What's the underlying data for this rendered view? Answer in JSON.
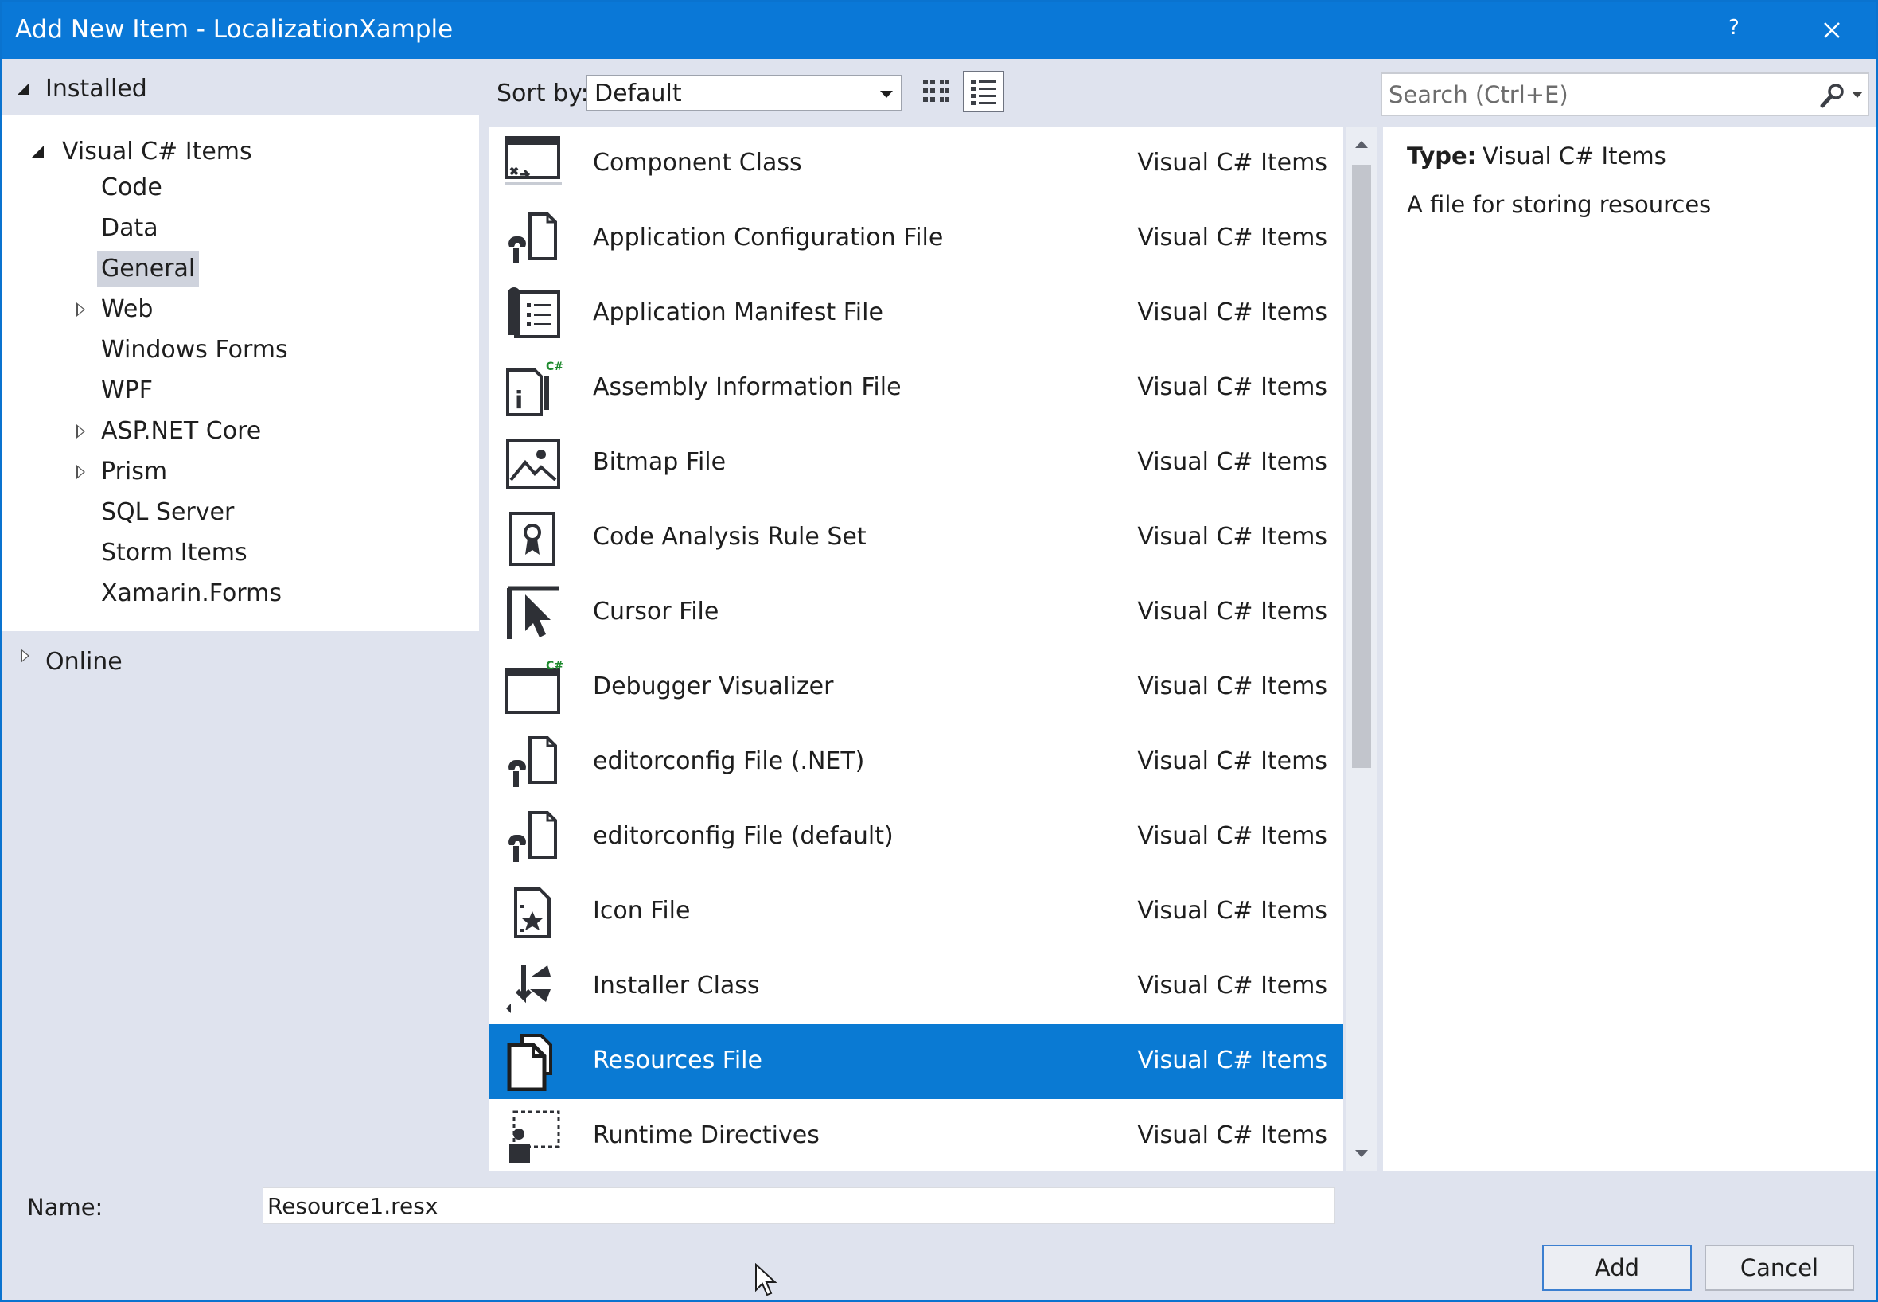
{
  "window": {
    "title": "Add New Item - LocalizationXample",
    "help_label": "?"
  },
  "tree": {
    "installed_label": "Installed",
    "root_label": "Visual C# Items",
    "children": [
      {
        "label": "Code",
        "expandable": false
      },
      {
        "label": "Data",
        "expandable": false
      },
      {
        "label": "General",
        "expandable": false,
        "selected": true
      },
      {
        "label": "Web",
        "expandable": true
      },
      {
        "label": "Windows Forms",
        "expandable": false
      },
      {
        "label": "WPF",
        "expandable": false
      },
      {
        "label": "ASP.NET Core",
        "expandable": true
      },
      {
        "label": "Prism",
        "expandable": true
      },
      {
        "label": "SQL Server",
        "expandable": false
      },
      {
        "label": "Storm Items",
        "expandable": false
      },
      {
        "label": "Xamarin.Forms",
        "expandable": false
      }
    ],
    "online_label": "Online"
  },
  "sort": {
    "label": "Sort by:",
    "value": "Default"
  },
  "search": {
    "placeholder": "Search (Ctrl+E)"
  },
  "items": [
    {
      "name": "Component Class",
      "category": "Visual C# Items",
      "icon": "component-class-icon"
    },
    {
      "name": "Application Configuration File",
      "category": "Visual C# Items",
      "icon": "config-file-icon"
    },
    {
      "name": "Application Manifest File",
      "category": "Visual C# Items",
      "icon": "manifest-file-icon"
    },
    {
      "name": "Assembly Information File",
      "category": "Visual C# Items",
      "icon": "assembly-info-icon"
    },
    {
      "name": "Bitmap File",
      "category": "Visual C# Items",
      "icon": "bitmap-file-icon"
    },
    {
      "name": "Code Analysis Rule Set",
      "category": "Visual C# Items",
      "icon": "rule-set-icon"
    },
    {
      "name": "Cursor File",
      "category": "Visual C# Items",
      "icon": "cursor-file-icon"
    },
    {
      "name": "Debugger Visualizer",
      "category": "Visual C# Items",
      "icon": "debugger-visualizer-icon"
    },
    {
      "name": "editorconfig File (.NET)",
      "category": "Visual C# Items",
      "icon": "config-file-icon"
    },
    {
      "name": "editorconfig File (default)",
      "category": "Visual C# Items",
      "icon": "config-file-icon"
    },
    {
      "name": "Icon File",
      "category": "Visual C# Items",
      "icon": "icon-file-icon"
    },
    {
      "name": "Installer Class",
      "category": "Visual C# Items",
      "icon": "installer-class-icon"
    },
    {
      "name": "Resources File",
      "category": "Visual C# Items",
      "icon": "resources-file-icon",
      "selected": true
    },
    {
      "name": "Runtime Directives",
      "category": "Visual C# Items",
      "icon": "runtime-directives-icon"
    }
  ],
  "details": {
    "type_label": "Type:",
    "type_value": "Visual C# Items",
    "description": "A file for storing resources"
  },
  "footer": {
    "name_label": "Name:",
    "name_value": "Resource1.resx",
    "add_label": "Add",
    "cancel_label": "Cancel"
  },
  "colors": {
    "accent": "#0a78d7",
    "selection": "#0a7ad3",
    "panel_bg": "#dfe3ee"
  }
}
